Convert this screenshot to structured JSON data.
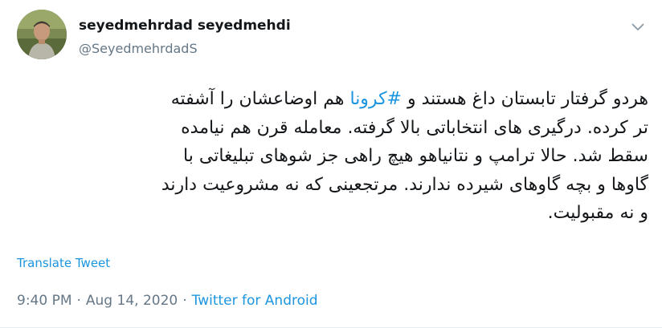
{
  "tweet": {
    "author": {
      "display_name": "seyedmehrdad seyedmehdi",
      "handle": "@SeyedmehrdadS"
    },
    "text": {
      "before_hashtag": "هردو گرفتار تابستان داغ هستند و ",
      "hashtag": "#کرونا",
      "after_hashtag": " هم اوضاعشان را آشفته تر کرده. درگیری های انتخاباتی  بالا گرفته. معامله قرن هم  نیامده سقط شد. حالا ترامپ و نتانیاهو هیچ راهی جز شوهای تبلیغاتی با گاوها و بچه گاوهای شیرده ندارند. مرتجعینی که نه مشروعیت دارند و نه مقبولیت."
    },
    "translate_label": "Translate Tweet",
    "time": "9:40 PM",
    "separator": "·",
    "date": "Aug 14, 2020",
    "source": "Twitter for Android"
  },
  "icons": {
    "more": "chevron-down-icon"
  },
  "colors": {
    "link": "#1b95e0",
    "secondary_text": "#657786",
    "primary_text": "#14171a"
  }
}
